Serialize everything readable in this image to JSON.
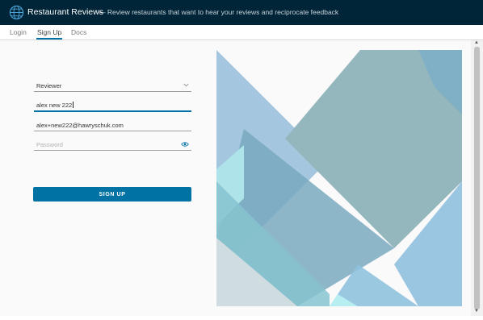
{
  "header": {
    "title": "Restaurant Reviews",
    "subtitle": "— Review restaurants that want to hear your reviews and reciprocate feedback",
    "logo_icon": "globe-icon",
    "background": "#002538"
  },
  "nav": {
    "tabs": [
      {
        "label": "Login",
        "active": false
      },
      {
        "label": "Sign Up",
        "active": true
      },
      {
        "label": "Docs",
        "active": false
      }
    ],
    "accent": "#0072a3"
  },
  "form": {
    "role": {
      "value": "Reviewer",
      "options": [
        "Reviewer"
      ]
    },
    "username": {
      "value": "alex new 222"
    },
    "email": {
      "value": "alex+new222@hawryschuk.com"
    },
    "password": {
      "value": "",
      "placeholder": "Password"
    },
    "submit_label": "SIGN UP"
  }
}
